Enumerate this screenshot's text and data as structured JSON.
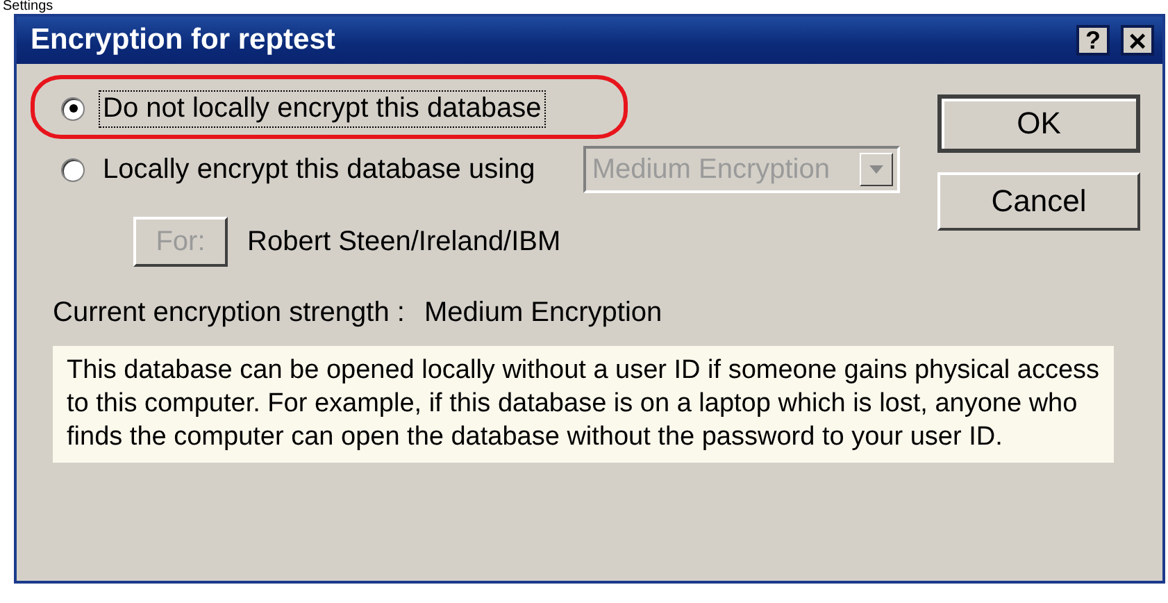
{
  "background_text": "Settings",
  "window": {
    "title": "Encryption for reptest",
    "title_buttons": [
      {
        "kind": "help",
        "label": "?"
      },
      {
        "kind": "close",
        "label": "×"
      }
    ]
  },
  "options": [
    {
      "label": "Do not locally encrypt this database",
      "selected": true,
      "focused": true,
      "highlighted": true
    },
    {
      "label": "Locally encrypt this database using",
      "selected": false,
      "focused": false,
      "highlighted": false,
      "dropdown": {
        "value": "Medium Encryption",
        "disabled": true
      }
    }
  ],
  "for_button": {
    "label": "For:",
    "disabled": true
  },
  "for_value": "Robert Steen/Ireland/IBM",
  "strength": {
    "label": "Current encryption strength :",
    "value": "Medium Encryption"
  },
  "info": "This database can be opened locally without a user ID if someone gains physical access to this computer. For example, if this database is on a laptop which is lost, anyone who finds the computer can open the database without the password to your user ID.",
  "buttons": [
    {
      "label": "OK",
      "default": true
    },
    {
      "label": "Cancel",
      "default": false
    }
  ]
}
